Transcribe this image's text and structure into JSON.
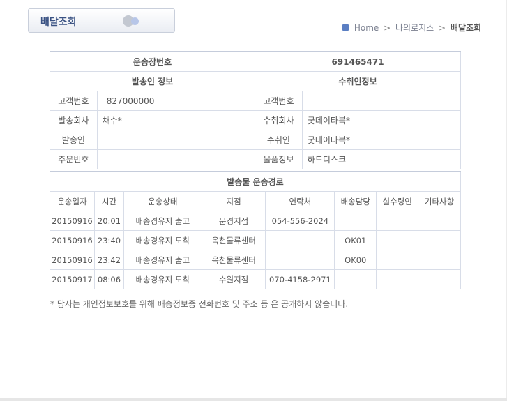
{
  "title": {
    "label": "배달조회"
  },
  "breadcrumb": {
    "home": "Home",
    "sep": ">",
    "level1": "나의로지스",
    "current": "배달조회"
  },
  "info": {
    "waybill_label": "운송장번호",
    "waybill_value": "691465471",
    "sender_header": "발송인 정보",
    "receiver_header": "수취인정보",
    "rows": [
      {
        "left_label": "고객번호",
        "left_value": "827000000",
        "right_label": "고객번호",
        "right_value": ""
      },
      {
        "left_label": "발송회사",
        "left_value": "채수*",
        "right_label": "수취회사",
        "right_value": "굿데이타북*"
      },
      {
        "left_label": "발송인",
        "left_value": "",
        "right_label": "수취인",
        "right_value": "굿데이타북*"
      },
      {
        "left_label": "주문번호",
        "left_value": "",
        "right_label": "물품정보",
        "right_value": "하드디스크"
      }
    ]
  },
  "route": {
    "title": "발송물 운송경로",
    "columns": [
      "운송일자",
      "시간",
      "운송상태",
      "지점",
      "연락처",
      "배송담당",
      "실수령인",
      "기타사항"
    ],
    "rows": [
      [
        "20150916",
        "20:01",
        "배송경유지 출고",
        "문경지점",
        "054-556-2024",
        "",
        "",
        ""
      ],
      [
        "20150916",
        "23:40",
        "배송경유지 도착",
        "옥천물류센터",
        "",
        "OK01",
        "",
        ""
      ],
      [
        "20150916",
        "23:42",
        "배송경유지 출고",
        "옥천물류센터",
        "",
        "OK00",
        "",
        ""
      ],
      [
        "20150917",
        "08:06",
        "배송경유지 도착",
        "수원지점",
        "070-4158-2971",
        "",
        "",
        ""
      ]
    ]
  },
  "notice": "* 당사는 개인정보보호를 위해 배송정보중 전화번호 및 주소 등 은 공개하지 않습니다."
}
